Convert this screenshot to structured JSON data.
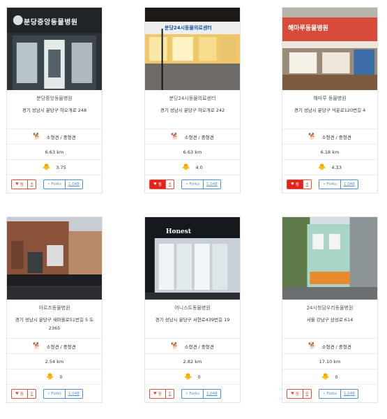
{
  "cards": [
    {
      "name": "분당중앙동물병원",
      "address": "경기 성남시 분당구 하오개로 248",
      "kind": "소형견 / 중형견",
      "distance": "6.63 km",
      "rating": "3.75",
      "like_label": "찜",
      "like_count": "4",
      "fork_label": "Forks",
      "fork_count": "1,048",
      "sign": "분당중앙동물병원",
      "like_active": false
    },
    {
      "name": "분당24시동물의료센터",
      "address": "경기 성남시 분당구 하오개로 242",
      "kind": "소형견 / 중형견",
      "distance": "6.63 km",
      "rating": "4.0",
      "like_label": "찜",
      "like_count": "4",
      "fork_label": "Forks",
      "fork_count": "1,048",
      "sign": "분당24시동물의료센터",
      "like_active": true
    },
    {
      "name": "해마루 동물병원",
      "address": "경기 성남시 분당구 석운로120번길 4",
      "kind": "소형견 / 중형견",
      "distance": "6.18 km",
      "rating": "4.33",
      "like_label": "찜",
      "like_count": "4",
      "fork_label": "Forks",
      "fork_count": "1,048",
      "sign": "해마루동물병원",
      "like_active": true
    },
    {
      "name": "아르즈동물병원",
      "address": "경기 성남시 분당구 새마을로51번길 5 도 2365",
      "kind": "소형견 / 중형견",
      "distance": "2.54 km",
      "rating": "0",
      "like_label": "찜",
      "like_count": "1",
      "fork_label": "Forks",
      "fork_count": "1,048",
      "sign": "",
      "like_active": false
    },
    {
      "name": "어니스트동물병원",
      "address": "경기 성남시 분당구 서현로439번길 19",
      "kind": "소형견 / 중형견",
      "distance": "2.82 km",
      "rating": "0",
      "like_label": "찜",
      "like_count": "1",
      "fork_label": "Forks",
      "fork_count": "1,048",
      "sign": "Honest",
      "like_active": false
    },
    {
      "name": "24시청담우리동물병원",
      "address": "서울 강남구 삼성로 614",
      "kind": "소형견 / 중형견",
      "distance": "17.10 km",
      "rating": "0",
      "like_label": "찜",
      "like_count": "0",
      "fork_label": "Forks",
      "fork_count": "1,048",
      "sign": "",
      "like_active": false
    }
  ],
  "colors": {
    "like_red": "#e8201a",
    "fork_blue": "#4a90d9"
  },
  "icons": {
    "kind": "dog-icon",
    "rating": "chick-icon",
    "like": "heart-icon",
    "fork": "fork-icon"
  }
}
